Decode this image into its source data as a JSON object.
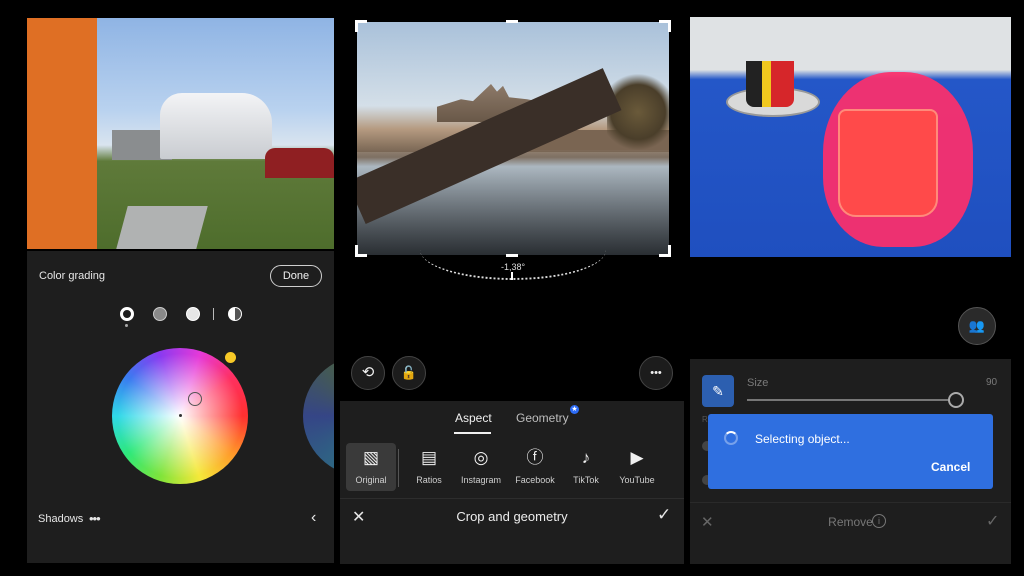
{
  "color_grading": {
    "title": "Color grading",
    "done_label": "Done",
    "section_label": "Shadows",
    "more_label": "•••",
    "back_glyph": "‹",
    "wheel_accent_color": "#f7c927"
  },
  "crop": {
    "angle": "-1,38°",
    "tabs": [
      {
        "label": "Aspect",
        "selected": true
      },
      {
        "label": "Geometry",
        "selected": false,
        "badge": "★"
      }
    ],
    "options": [
      {
        "label": "Original",
        "icon": "image-icon",
        "glyph": "▧",
        "selected": true
      },
      {
        "label": "Ratios",
        "icon": "ratios-icon",
        "glyph": "▤"
      },
      {
        "label": "Instagram",
        "icon": "instagram-icon",
        "glyph": "◎"
      },
      {
        "label": "Facebook",
        "icon": "facebook-icon",
        "glyph": "ⓕ"
      },
      {
        "label": "TikTok",
        "icon": "tiktok-icon",
        "glyph": "♪"
      },
      {
        "label": "YouTube",
        "icon": "youtube-icon",
        "glyph": "▶"
      }
    ],
    "footer_title": "Crop and geometry",
    "close_glyph": "✕",
    "confirm_glyph": "✓",
    "rotate_glyph": "⟲",
    "unlock_glyph": "🔓",
    "more_glyph": "•••"
  },
  "remove": {
    "size_label": "Size",
    "size_value": "90",
    "size_fraction": 0.9,
    "dim_label": "R",
    "dialog_message": "Selecting object...",
    "dialog_cancel": "Cancel",
    "footer_title": "Remove",
    "info_glyph": "i",
    "close_glyph": "✕",
    "confirm_glyph": "✓",
    "people_glyph": "👥",
    "brush_glyph": "✎",
    "accent_color": "#2f6fe0",
    "mask_color": "#ff2f6a"
  }
}
